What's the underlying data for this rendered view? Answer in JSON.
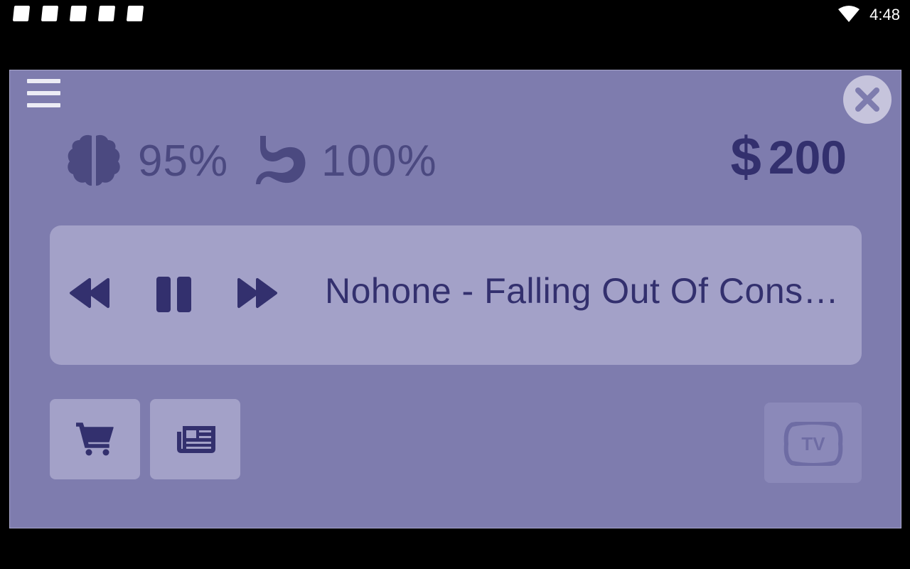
{
  "status_bar": {
    "time": "4:48",
    "notification_icons": [
      "notification-icon",
      "notification-icon",
      "notification-icon",
      "notification-icon",
      "notification-icon"
    ],
    "wifi_icon": "wifi-icon"
  },
  "game": {
    "menu_icon": "hamburger-menu-icon",
    "close_icon": "close-icon",
    "stats": {
      "brain": {
        "icon": "brain-icon",
        "value": "95%"
      },
      "stomach": {
        "icon": "stomach-icon",
        "value": "100%"
      }
    },
    "money": {
      "symbol": "$",
      "value": "200"
    },
    "player": {
      "rewind_icon": "rewind-icon",
      "pause_icon": "pause-icon",
      "fast_forward_icon": "fast-forward-icon",
      "track_title": "Nohone - Falling Out Of Consc…"
    },
    "buttons": {
      "shop_icon": "shopping-cart-icon",
      "news_icon": "newspaper-icon",
      "tv_icon": "tv-icon",
      "tv_label": "TV"
    },
    "colors": {
      "background": "#7e7cae",
      "card": "#a3a1c8",
      "accent_dark": "#33306e",
      "stat_text": "#4b4980"
    }
  }
}
